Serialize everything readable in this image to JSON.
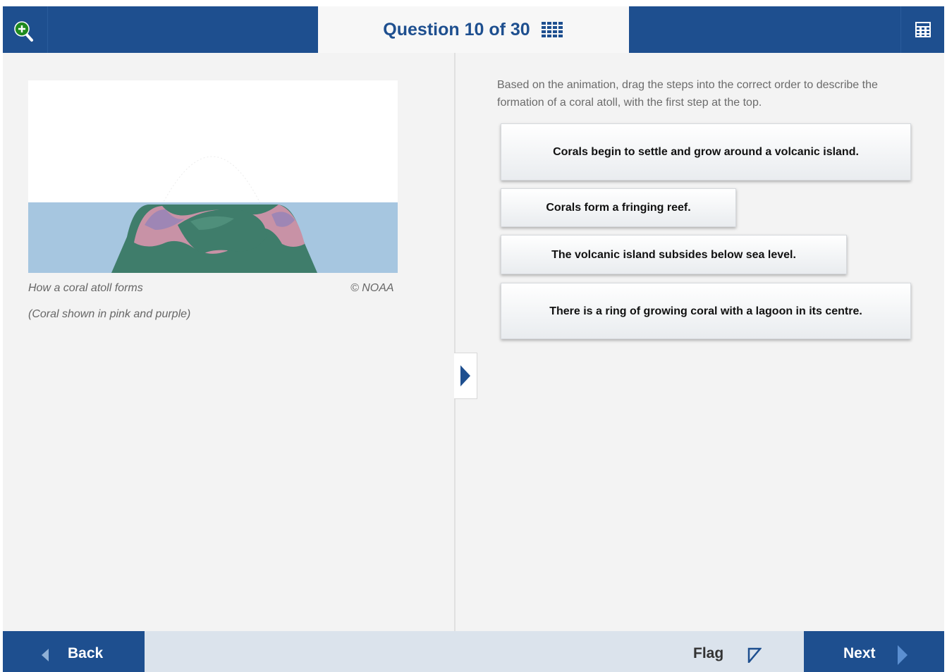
{
  "header": {
    "question_label": "Question 10 of 30",
    "zoom_icon": "zoom-in-icon",
    "grid_icon": "question-grid-icon",
    "calculator_icon": "calculator-icon",
    "color": "#1e4f8f"
  },
  "figure": {
    "caption": "How a coral atoll forms",
    "credit": "© NOAA",
    "note": "(Coral shown in pink and purple)"
  },
  "question": {
    "instructions": "Based on the animation, drag the steps into the correct order to describe the formation of a coral atoll, with the first step at the top.",
    "steps": [
      "Corals begin to settle and grow around a volcanic island.",
      "Corals form a fringing reef.",
      "The volcanic island subsides below sea level.",
      "There is a ring of growing coral with a lagoon in its centre."
    ]
  },
  "footer": {
    "back_label": "Back",
    "flag_label": "Flag",
    "next_label": "Next"
  }
}
